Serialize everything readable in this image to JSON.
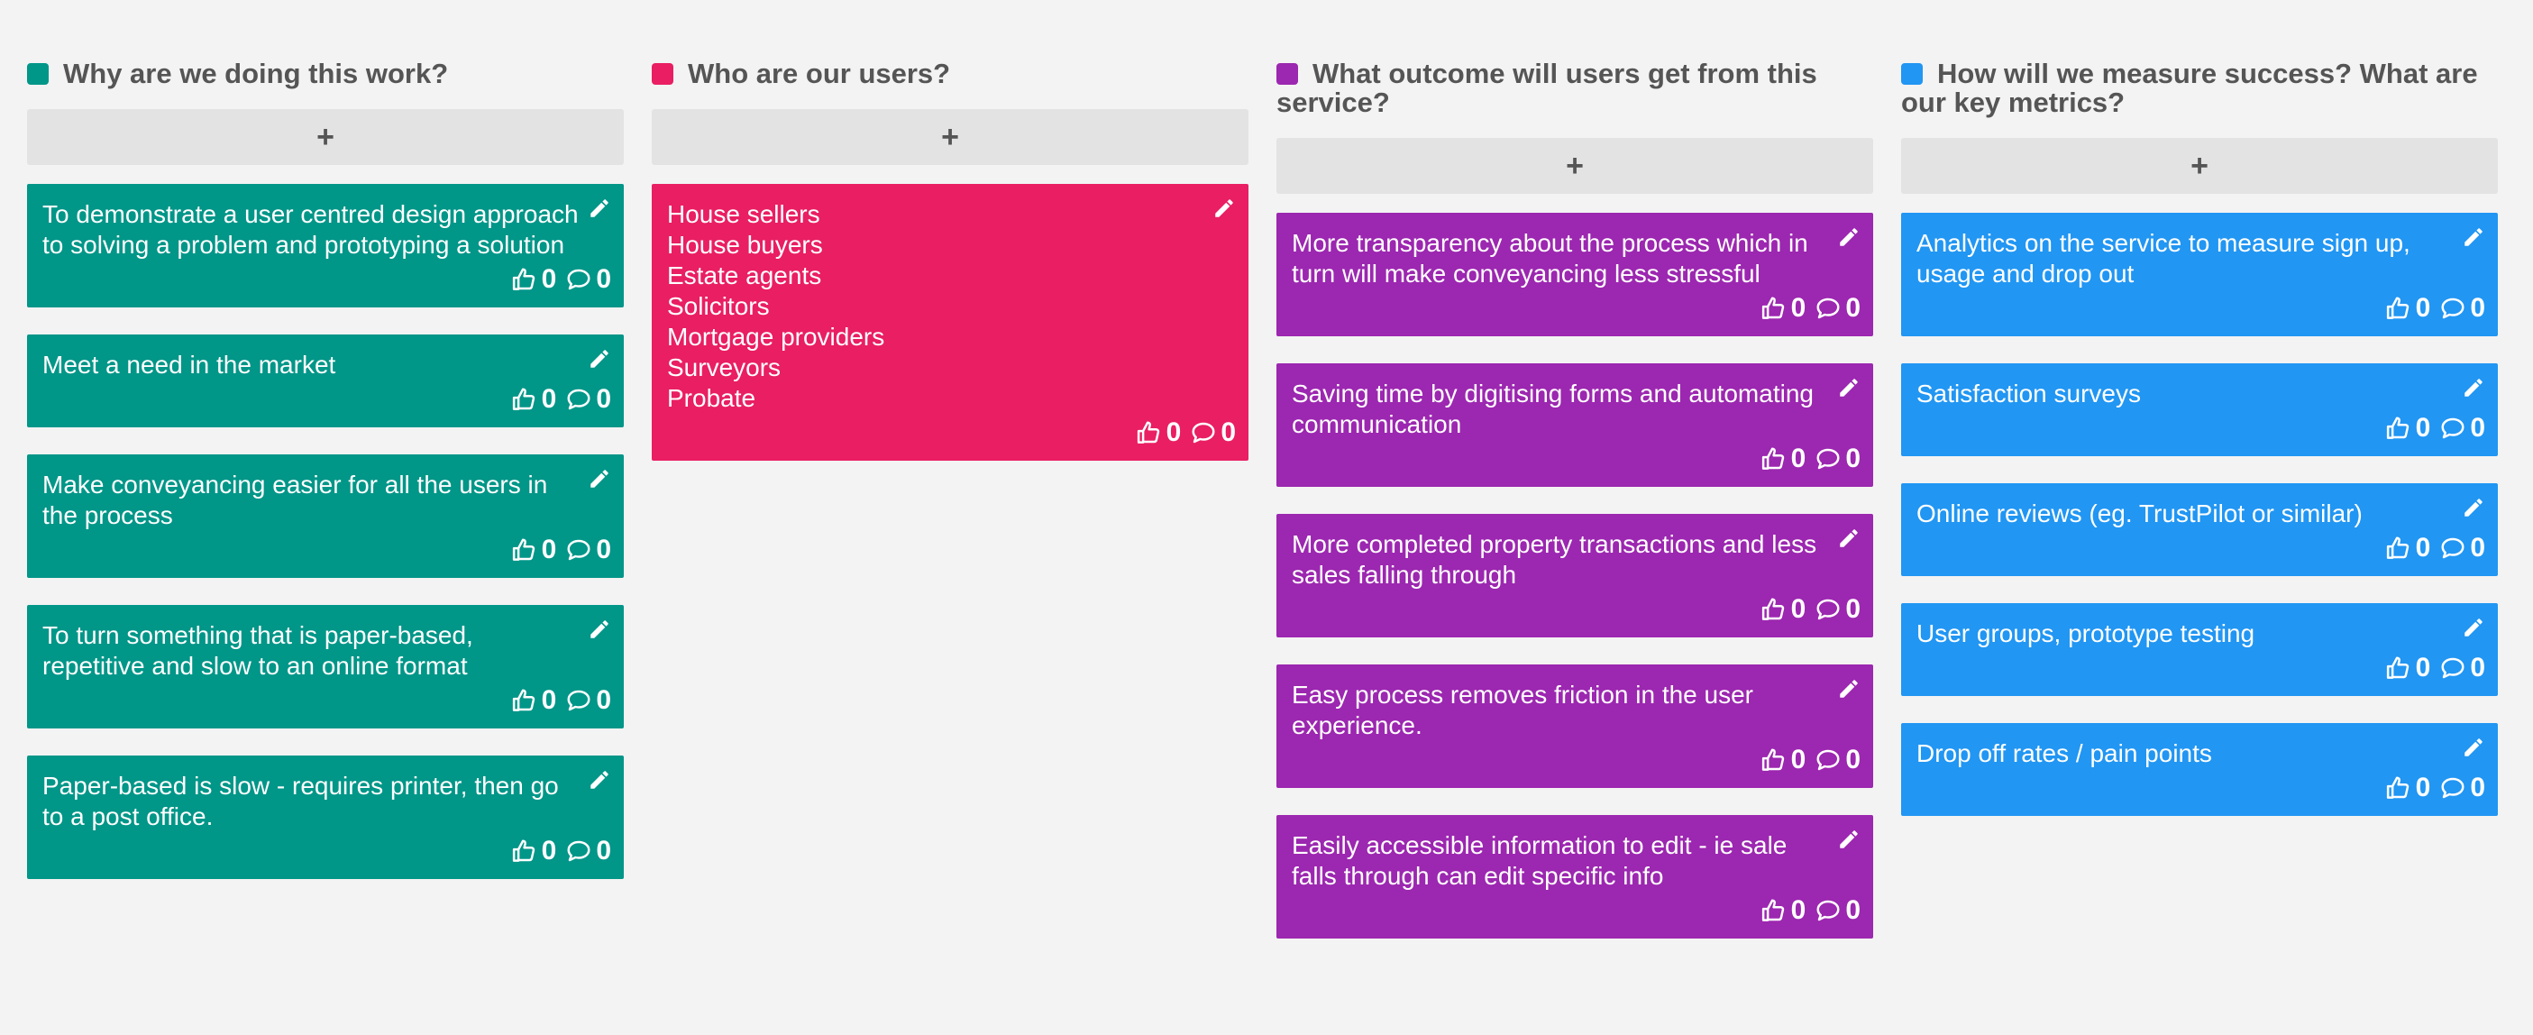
{
  "add_label": "+",
  "columns": [
    {
      "title": "Why are we doing this work?",
      "color": "#009688",
      "cards": [
        {
          "text": "To demonstrate a user centred design approach to solving a problem and prototyping a solution",
          "votes": "0",
          "comments": "0"
        },
        {
          "text": "Meet a need in the market",
          "votes": "0",
          "comments": "0"
        },
        {
          "text": "Make conveyancing easier for all the users in the process",
          "votes": "0",
          "comments": "0"
        },
        {
          "text": "To turn something that is paper-based, repetitive and slow to an online format",
          "votes": "0",
          "comments": "0"
        },
        {
          "text": "Paper-based is slow - requires printer, then go to a post office.",
          "votes": "0",
          "comments": "0"
        }
      ]
    },
    {
      "title": "Who are our users?",
      "color": "#e91e63",
      "cards": [
        {
          "text": "House sellers\nHouse buyers\nEstate agents\nSolicitors\nMortgage providers\nSurveyors\nProbate",
          "votes": "0",
          "comments": "0"
        }
      ]
    },
    {
      "title": "What outcome will users get from this service?",
      "color": "#9c27b0",
      "cards": [
        {
          "text": "More transparency about the process which in turn will make conveyancing less stressful",
          "votes": "0",
          "comments": "0"
        },
        {
          "text": "Saving time by digitising forms and automating communication",
          "votes": "0",
          "comments": "0"
        },
        {
          "text": "More completed property transactions and less sales falling through",
          "votes": "0",
          "comments": "0"
        },
        {
          "text": "Easy process removes friction in the user experience.",
          "votes": "0",
          "comments": "0"
        },
        {
          "text": "Easily accessible information to edit - ie sale falls through can edit specific info",
          "votes": "0",
          "comments": "0"
        }
      ]
    },
    {
      "title": "How will we measure success? What are our key metrics?",
      "color": "#2196f3",
      "cards": [
        {
          "text": "Analytics on the service to measure sign up, usage and drop out",
          "votes": "0",
          "comments": "0"
        },
        {
          "text": "Satisfaction surveys",
          "votes": "0",
          "comments": "0"
        },
        {
          "text": "Online reviews (eg. TrustPilot or similar)",
          "votes": "0",
          "comments": "0"
        },
        {
          "text": "User groups, prototype testing",
          "votes": "0",
          "comments": "0"
        },
        {
          "text": "Drop off rates / pain points",
          "votes": "0",
          "comments": "0"
        }
      ]
    }
  ]
}
